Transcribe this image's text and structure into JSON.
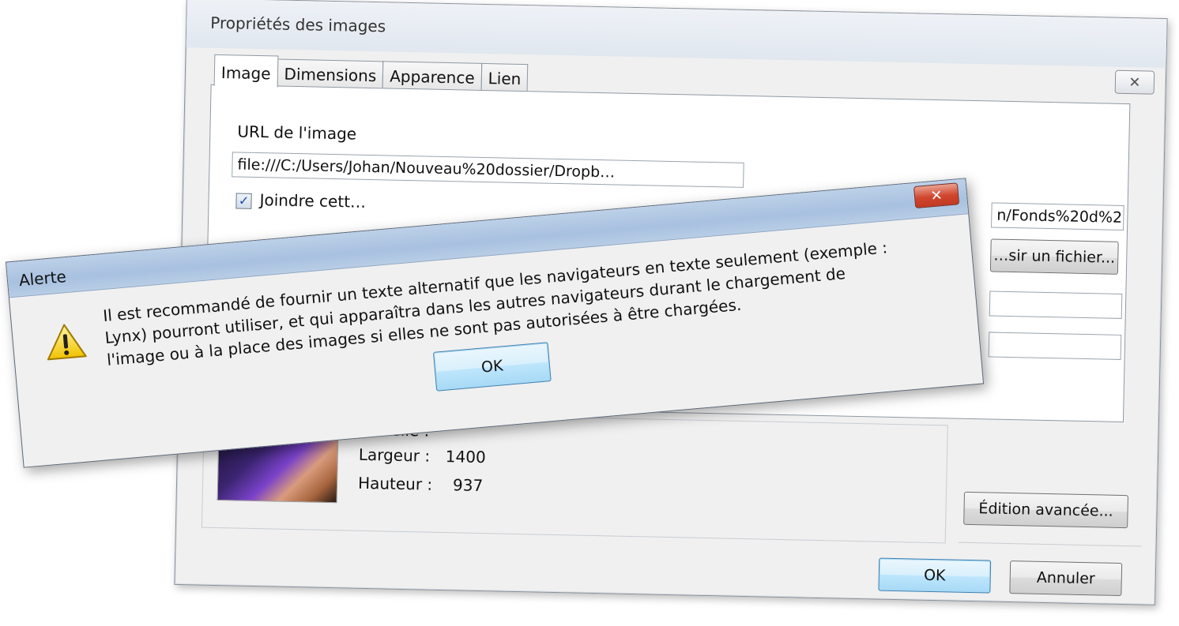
{
  "props_dialog": {
    "title": "Propriétés des images",
    "close_glyph": "✕",
    "tabs": [
      {
        "label": "Image"
      },
      {
        "label": "Dimensions"
      },
      {
        "label": "Apparence"
      },
      {
        "label": "Lien"
      }
    ],
    "url_label": "URL de l'image",
    "url_value": "file:///C:/Users/Johan/Nouveau%20dossier/Dropb…",
    "attach_checkbox_label": "Joindre cett…",
    "relative_path_value": "n/Fonds%20d%2",
    "choose_file_label": "…sir un fichier...",
    "preview": {
      "label": "…réelle :",
      "width_label": "Largeur :",
      "width_value": "1400",
      "height_label": "Hauteur :",
      "height_value": "937"
    },
    "advanced_edit_label": "Édition avancée...",
    "ok_label": "OK",
    "cancel_label": "Annuler"
  },
  "alert_dialog": {
    "title": "Alerte",
    "close_glyph": "✕",
    "message_lines": [
      "Il est recommandé de fournir un texte alternatif que les navigateurs en texte seulement (exemple :",
      "Lynx) pourront utiliser, et qui apparaîtra dans les autres navigateurs durant le chargement de",
      "l'image ou à la place des images si elles ne sont pas autorisées à être chargées."
    ],
    "ok_label": "OK",
    "icon": "warning-icon"
  }
}
